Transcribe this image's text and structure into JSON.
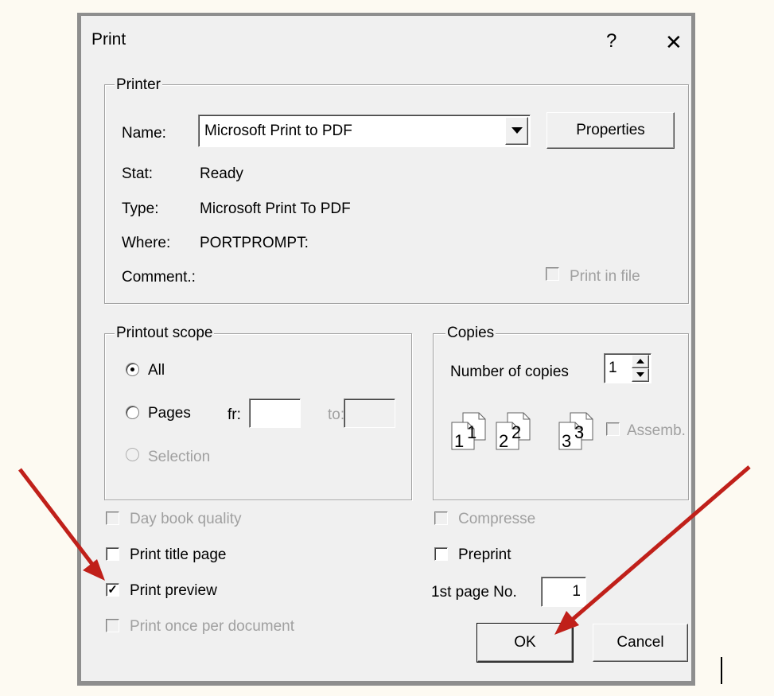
{
  "dialog": {
    "title": "Print",
    "help_glyph": "?",
    "close_glyph": "✕"
  },
  "printer": {
    "group_label": "Printer",
    "name_label": "Name:",
    "name_value": "Microsoft Print to PDF",
    "properties_label": "Properties",
    "stat_label": "Stat:",
    "stat_value": "Ready",
    "type_label": "Type:",
    "type_value": "Microsoft Print To PDF",
    "where_label": "Where:",
    "where_value": "PORTPROMPT:",
    "comment_label": "Comment.:",
    "print_in_file_label": "Print in file",
    "print_in_file_checked": false
  },
  "scope": {
    "group_label": "Printout scope",
    "all_label": "All",
    "pages_label": "Pages",
    "from_label": "fr:",
    "to_label": "to:",
    "from_value": "",
    "to_value": "",
    "selection_label": "Selection",
    "selected": "All"
  },
  "copies": {
    "group_label": "Copies",
    "number_label": "Number of copies",
    "number_value": "1",
    "assemble_label": "Assemb.",
    "assemble_checked": false,
    "page_icons": [
      {
        "big": "1",
        "small": "1"
      },
      {
        "big": "2",
        "small": "2"
      },
      {
        "big": "3",
        "small": "3"
      }
    ]
  },
  "options": {
    "day_book_label": "Day book quality",
    "print_title_label": "Print title page",
    "print_preview_label": "Print preview",
    "print_preview_checked": true,
    "print_once_label": "Print once per document",
    "compressed_label": "Compresse",
    "preprint_label": "Preprint",
    "first_page_label": "1st page No.",
    "first_page_value": "1"
  },
  "buttons": {
    "ok_label": "OK",
    "cancel_label": "Cancel"
  },
  "colors": {
    "arrow": "#c0201a",
    "dialog_bg": "#f0f0f0",
    "disabled_text": "#a0a0a0"
  }
}
